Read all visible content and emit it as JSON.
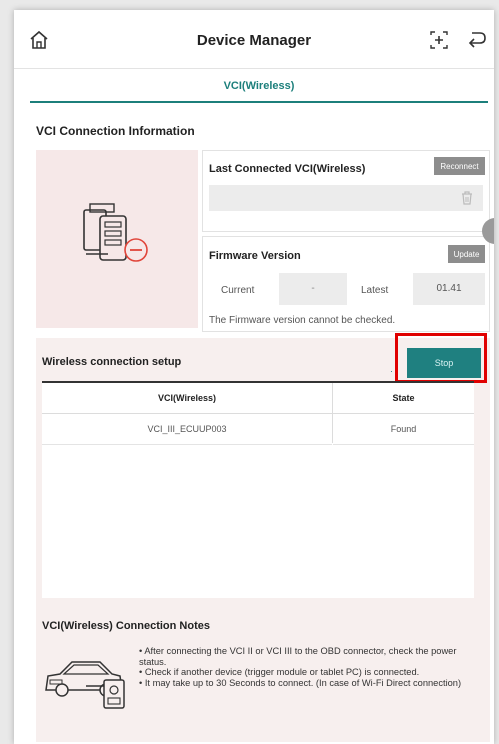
{
  "header": {
    "title": "Device Manager",
    "home_icon": "home-icon",
    "add_icon": "add-device-icon",
    "exit_icon": "exit-icon"
  },
  "tabs": [
    {
      "label": "VCI(Wireless)",
      "active": true
    }
  ],
  "connection_info": {
    "title": "VCI Connection Information",
    "last_connected": {
      "label": "Last Connected VCI(Wireless)",
      "reconnect_label": "Reconnect",
      "value": "",
      "delete_icon": "trash-icon"
    },
    "firmware": {
      "label": "Firmware Version",
      "update_label": "Update",
      "current_label": "Current",
      "current_value": "-",
      "latest_label": "Latest",
      "latest_value": "01.41",
      "message": "The Firmware version cannot be checked."
    }
  },
  "wireless_setup": {
    "title": "Wireless connection setup",
    "stop_label": "Stop",
    "columns": [
      "VCI(Wireless)",
      "State"
    ],
    "rows": [
      {
        "vci": "VCI_III_ECUUP003",
        "state": "Found"
      }
    ]
  },
  "notes": {
    "title": "VCI(Wireless) Connection Notes",
    "lines": [
      "• After connecting the VCI II or VCI III to the OBD connector, check the power status.",
      "• Check if another device (trigger module or tablet PC) is connected.",
      "• It may take up to 30 Seconds to connect. (In case of Wi-Fi Direct connection)"
    ]
  },
  "colors": {
    "accent": "#1f8080",
    "highlight_frame": "#e00000",
    "panel_bg": "#f7efee"
  }
}
